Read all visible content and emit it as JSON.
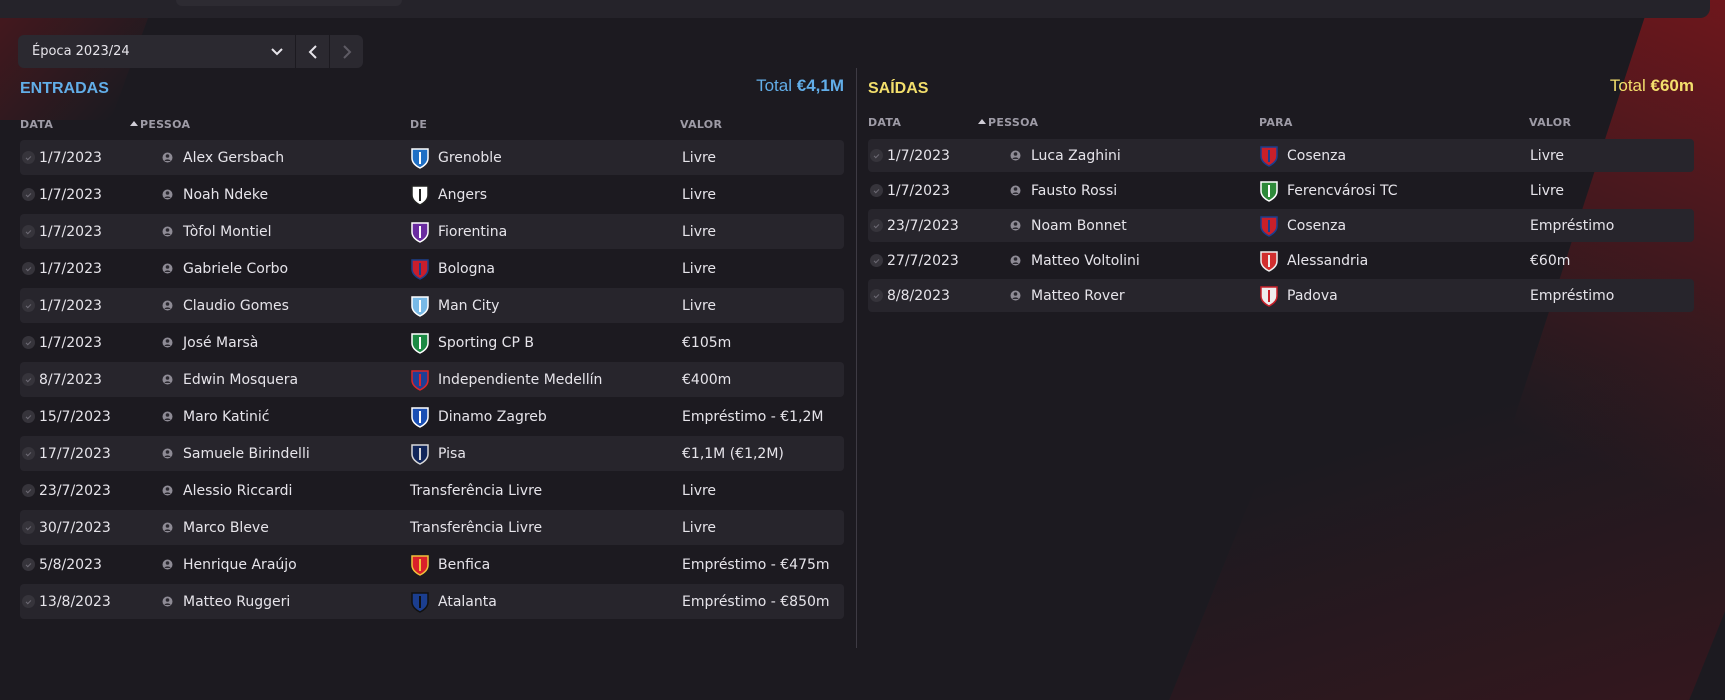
{
  "season": {
    "label": "Época 2023/24"
  },
  "colors": {
    "entradas_accent": "#62aee8",
    "saidas_accent": "#f3df6c",
    "background": "#1c1a20"
  },
  "entradas": {
    "title": "ENTRADAS",
    "total_label": "Total",
    "total_value": "€4,1M",
    "headers": {
      "date": "DATA",
      "person": "PESSOA",
      "club": "DE",
      "value": "VALOR"
    },
    "rows": [
      {
        "date": "1/7/2023",
        "person": "Alex Gersbach",
        "club": "Grenoble",
        "crest": "grenoble-crest",
        "value": "Livre"
      },
      {
        "date": "1/7/2023",
        "person": "Noah Ndeke",
        "club": "Angers",
        "crest": "angers-crest",
        "value": "Livre"
      },
      {
        "date": "1/7/2023",
        "person": "Tòfol Montiel",
        "club": "Fiorentina",
        "crest": "fiorentina-crest",
        "value": "Livre"
      },
      {
        "date": "1/7/2023",
        "person": "Gabriele Corbo",
        "club": "Bologna",
        "crest": "bologna-crest",
        "value": "Livre"
      },
      {
        "date": "1/7/2023",
        "person": "Claudio Gomes",
        "club": "Man City",
        "crest": "man-city-crest",
        "value": "Livre"
      },
      {
        "date": "1/7/2023",
        "person": "José Marsà",
        "club": "Sporting CP B",
        "crest": "sporting-crest",
        "value": "€105m"
      },
      {
        "date": "8/7/2023",
        "person": "Edwin Mosquera",
        "club": "Independiente Medellín",
        "crest": "medellin-crest",
        "value": "€400m"
      },
      {
        "date": "15/7/2023",
        "person": "Maro Katinić",
        "club": "Dinamo Zagreb",
        "crest": "dinamo-zagreb-crest",
        "value": "Empréstimo - €1,2M"
      },
      {
        "date": "17/7/2023",
        "person": "Samuele Birindelli",
        "club": "Pisa",
        "crest": "pisa-crest",
        "value": "€1,1M (€1,2M)"
      },
      {
        "date": "23/7/2023",
        "person": "Alessio Riccardi",
        "club": "Transferência Livre",
        "crest": "",
        "value": "Livre"
      },
      {
        "date": "30/7/2023",
        "person": "Marco Bleve",
        "club": "Transferência Livre",
        "crest": "",
        "value": "Livre"
      },
      {
        "date": "5/8/2023",
        "person": "Henrique Araújo",
        "club": "Benfica",
        "crest": "benfica-crest",
        "value": "Empréstimo - €475m"
      },
      {
        "date": "13/8/2023",
        "person": "Matteo Ruggeri",
        "club": "Atalanta",
        "crest": "atalanta-crest",
        "value": "Empréstimo - €850m"
      }
    ]
  },
  "saidas": {
    "title": "SAÍDAS",
    "total_label": "Total",
    "total_value": "€60m",
    "headers": {
      "date": "DATA",
      "person": "PESSOA",
      "club": "PARA",
      "value": "VALOR"
    },
    "rows": [
      {
        "date": "1/7/2023",
        "person": "Luca Zaghini",
        "club": "Cosenza",
        "crest": "cosenza-crest",
        "value": "Livre"
      },
      {
        "date": "1/7/2023",
        "person": "Fausto Rossi",
        "club": "Ferencvárosi TC",
        "crest": "ferencvaros-crest",
        "value": "Livre"
      },
      {
        "date": "23/7/2023",
        "person": "Noam Bonnet",
        "club": "Cosenza",
        "crest": "cosenza-crest",
        "value": "Empréstimo"
      },
      {
        "date": "27/7/2023",
        "person": "Matteo Voltolini",
        "club": "Alessandria",
        "crest": "alessandria-crest",
        "value": "€60m"
      },
      {
        "date": "8/8/2023",
        "person": "Matteo Rover",
        "club": "Padova",
        "crest": "padova-crest",
        "value": "Empréstimo"
      }
    ]
  }
}
